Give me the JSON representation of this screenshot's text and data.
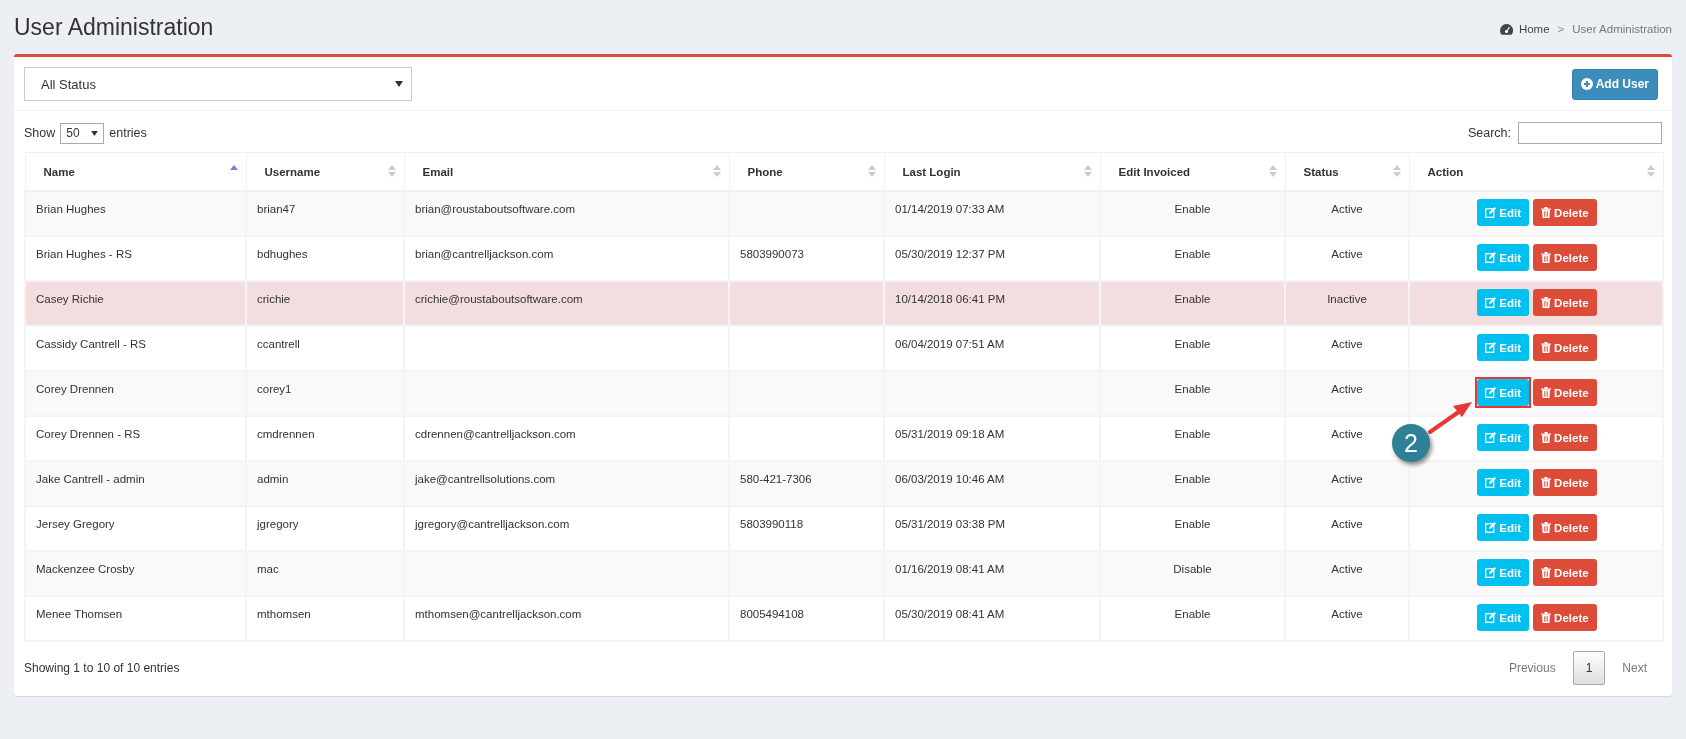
{
  "page_title": "User Administration",
  "breadcrumb": {
    "items": [
      "Home",
      "User Administration"
    ],
    "separator": ">"
  },
  "status_filter": {
    "value": "All Status"
  },
  "add_button": "Add User",
  "length_menu": {
    "before": "Show",
    "value": "50",
    "after": "entries"
  },
  "search": {
    "label": "Search:"
  },
  "columns": [
    {
      "label": "Name",
      "sorted": true
    },
    {
      "label": "Username",
      "sorted": false
    },
    {
      "label": "Email",
      "sorted": false
    },
    {
      "label": "Phone",
      "sorted": false
    },
    {
      "label": "Last Login",
      "sorted": false
    },
    {
      "label": "Edit Invoiced",
      "sorted": false
    },
    {
      "label": "Status",
      "sorted": false
    },
    {
      "label": "Action",
      "sorted": false
    }
  ],
  "rows": [
    {
      "name": "Brian Hughes",
      "username": "brian47",
      "email": "brian@roustaboutsoftware.com",
      "phone": "",
      "last_login": "01/14/2019 07:33 AM",
      "edit_invoiced": "Enable",
      "status": "Active",
      "inactive": false,
      "annotated": false,
      "edit": "Edit",
      "delete": "Delete"
    },
    {
      "name": "Brian Hughes - RS",
      "username": "bdhughes",
      "email": "brian@cantrelljackson.com",
      "phone": "5803990073",
      "last_login": "05/30/2019 12:37 PM",
      "edit_invoiced": "Enable",
      "status": "Active",
      "inactive": false,
      "annotated": false,
      "edit": "Edit",
      "delete": "Delete"
    },
    {
      "name": "Casey Richie",
      "username": "crichie",
      "email": "crichie@roustaboutsoftware.com",
      "phone": "",
      "last_login": "10/14/2018 06:41 PM",
      "edit_invoiced": "Enable",
      "status": "Inactive",
      "inactive": true,
      "annotated": false,
      "edit": "Edit",
      "delete": "Delete"
    },
    {
      "name": "Cassidy Cantrell - RS",
      "username": "ccantrell",
      "email": "",
      "phone": "",
      "last_login": "06/04/2019 07:51 AM",
      "edit_invoiced": "Enable",
      "status": "Active",
      "inactive": false,
      "annotated": false,
      "edit": "Edit",
      "delete": "Delete"
    },
    {
      "name": "Corey Drennen",
      "username": "corey1",
      "email": "",
      "phone": "",
      "last_login": "",
      "edit_invoiced": "Enable",
      "status": "Active",
      "inactive": false,
      "annotated": true,
      "edit": "Edit",
      "delete": "Delete"
    },
    {
      "name": "Corey Drennen - RS",
      "username": "cmdrennen",
      "email": "cdrennen@cantrelljackson.com",
      "phone": "",
      "last_login": "05/31/2019 09:18 AM",
      "edit_invoiced": "Enable",
      "status": "Active",
      "inactive": false,
      "annotated": false,
      "edit": "Edit",
      "delete": "Delete"
    },
    {
      "name": "Jake Cantrell - admin",
      "username": "admin",
      "email": "jake@cantrellsolutions.com",
      "phone": "580-421-7306",
      "last_login": "06/03/2019 10:46 AM",
      "edit_invoiced": "Enable",
      "status": "Active",
      "inactive": false,
      "annotated": false,
      "edit": "Edit",
      "delete": "Delete"
    },
    {
      "name": "Jersey Gregory",
      "username": "jgregory",
      "email": "jgregory@cantrelljackson.com",
      "phone": "5803990118",
      "last_login": "05/31/2019 03:38 PM",
      "edit_invoiced": "Enable",
      "status": "Active",
      "inactive": false,
      "annotated": false,
      "edit": "Edit",
      "delete": "Delete"
    },
    {
      "name": "Mackenzee Crosby",
      "username": "mac",
      "email": "",
      "phone": "",
      "last_login": "01/16/2019 08:41 AM",
      "edit_invoiced": "Disable",
      "status": "Active",
      "inactive": false,
      "annotated": false,
      "edit": "Edit",
      "delete": "Delete"
    },
    {
      "name": "Menee Thomsen",
      "username": "mthomsen",
      "email": "mthomsen@cantrelljackson.com",
      "phone": "8005494108",
      "last_login": "05/30/2019 08:41 AM",
      "edit_invoiced": "Enable",
      "status": "Active",
      "inactive": false,
      "annotated": false,
      "edit": "Edit",
      "delete": "Delete"
    }
  ],
  "callout": {
    "label": "2"
  },
  "info": "Showing 1 to 10 of 10 entries",
  "pagination": [
    {
      "label": "Previous",
      "selected": false
    },
    {
      "label": "1",
      "selected": true
    },
    {
      "label": "Next",
      "selected": false
    }
  ]
}
